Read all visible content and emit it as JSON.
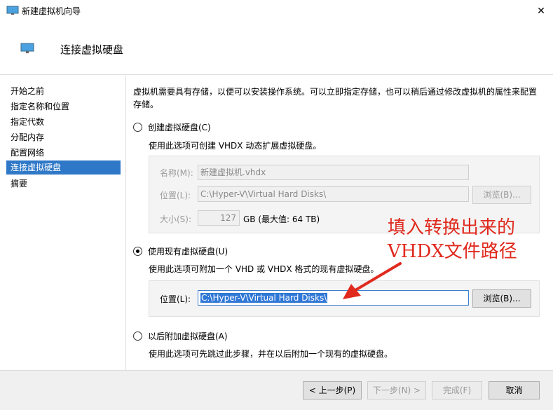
{
  "window": {
    "title": "新建虚拟机向导",
    "close_glyph": "✕"
  },
  "header": {
    "title": "连接虚拟硬盘"
  },
  "sidebar": {
    "items": [
      {
        "label": "开始之前"
      },
      {
        "label": "指定名称和位置"
      },
      {
        "label": "指定代数"
      },
      {
        "label": "分配内存"
      },
      {
        "label": "配置网络"
      },
      {
        "label": "连接虚拟硬盘",
        "active": true
      },
      {
        "label": "摘要"
      }
    ]
  },
  "content": {
    "description": "虚拟机需要具有存储，以便可以安装操作系统。可以立即指定存储，也可以稍后通过修改虚拟机的属性来配置存储。",
    "option_create": {
      "label": "创建虚拟硬盘(C)",
      "desc": "使用此选项可创建 VHDX 动态扩展虚拟硬盘。",
      "name_label": "名称(M):",
      "name_value": "新建虚拟机.vhdx",
      "location_label": "位置(L):",
      "location_value": "C:\\Hyper-V\\Virtual Hard Disks\\",
      "browse_label": "浏览(B)...",
      "size_label": "大小(S):",
      "size_value": "127",
      "size_unit": "GB (最大值: 64 TB)"
    },
    "option_existing": {
      "label": "使用现有虚拟硬盘(U)",
      "desc": "使用此选项可附加一个 VHD 或 VHDX 格式的现有虚拟硬盘。",
      "location_label": "位置(L):",
      "location_value": "C:\\Hyper-V\\Virtual Hard Disks\\",
      "browse_label": "浏览(B)..."
    },
    "option_later": {
      "label": "以后附加虚拟硬盘(A)",
      "desc": "使用此选项可先跳过此步骤，并在以后附加一个现有的虚拟硬盘。"
    }
  },
  "annotation": {
    "line1": "填入转换出来的",
    "line2": "VHDX文件路径"
  },
  "footer": {
    "prev": "< 上一步(P)",
    "next": "下一步(N) >",
    "finish": "完成(F)",
    "cancel": "取消"
  },
  "colors": {
    "accent": "#2f78c8",
    "annotation": "#e02a1e"
  }
}
